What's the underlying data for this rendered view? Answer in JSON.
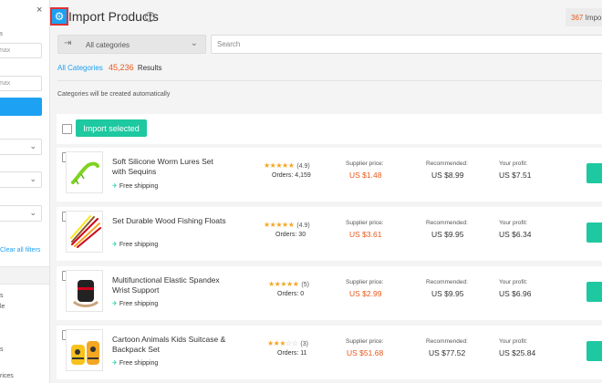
{
  "sidebar": {
    "close_glyph": "×",
    "price_label": "a",
    "max_placeholder": "max",
    "max_placeholder_2": "max",
    "clear_filters": "Clear all filters",
    "items": [
      "s",
      "le",
      "",
      "s",
      "",
      "rices"
    ]
  },
  "header": {
    "title": "Import Products",
    "help_glyph": "?",
    "count_num": "367",
    "count_text": "Import"
  },
  "filters": {
    "category": "All categories",
    "search_placeholder": "Search"
  },
  "breadcrumb": {
    "link": "All Categories",
    "total": "45,236",
    "results": "Results"
  },
  "note": "Categories will be created automatically",
  "toolbar": {
    "import_selected": "Import selected"
  },
  "labels": {
    "supplier": "Supplier price:",
    "recommended": "Recommended:",
    "profit": "Your profit:",
    "free_shipping": "Free shipping"
  },
  "products": [
    {
      "name": "Soft Silicone Worm Lures Set with Sequins",
      "stars": 5,
      "rating": "(4.9)",
      "orders_label": "Orders:",
      "orders": "4,159",
      "supplier": "US $1.48",
      "recommended": "US $8.99",
      "profit": "US $7.51"
    },
    {
      "name": "Set Durable Wood Fishing Floats",
      "stars": 5,
      "rating": "(4.9)",
      "orders_label": "Orders:",
      "orders": "30",
      "supplier": "US $3.61",
      "recommended": "US $9.95",
      "profit": "US $6.34"
    },
    {
      "name": "Multifunctional Elastic Spandex Wrist Support",
      "stars": 5,
      "rating": "(5)",
      "orders_label": "Orders:",
      "orders": "0",
      "supplier": "US $2.99",
      "recommended": "US $9.95",
      "profit": "US $6.96"
    },
    {
      "name": "Cartoon Animals Kids Suitcase & Backpack Set",
      "stars": 3,
      "rating": "(3)",
      "orders_label": "Orders:",
      "orders": "11",
      "supplier": "US $51.68",
      "recommended": "US $77.52",
      "profit": "US $25.84"
    }
  ],
  "colors": {
    "accent": "#1da1f2",
    "price": "#e8581c",
    "import": "#1ec8a0",
    "star": "#f5a623"
  }
}
